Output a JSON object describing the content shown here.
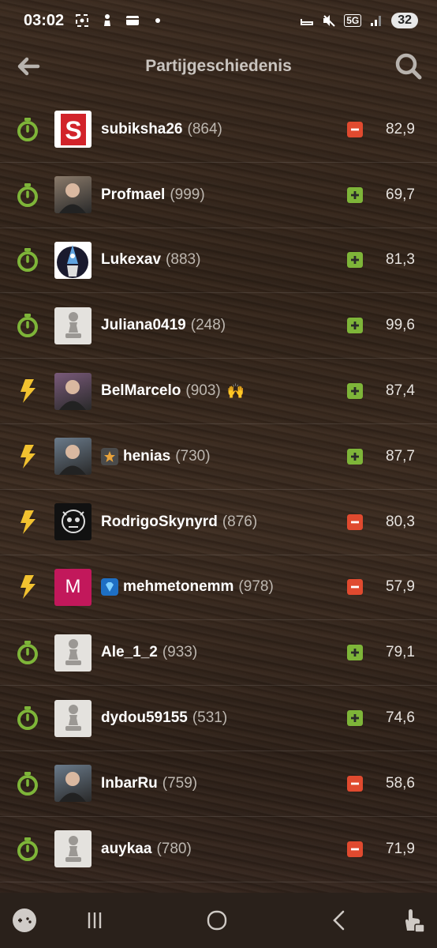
{
  "status": {
    "time": "03:02",
    "network": "5G",
    "battery": "32"
  },
  "header": {
    "title": "Partijgeschiedenis"
  },
  "colors": {
    "win": "#7eb539",
    "loss": "#e04a2f",
    "rapid_icon": "#7eb539",
    "blitz_icon": "#f2c230"
  },
  "games": [
    {
      "type": "rapid",
      "username": "subiksha26",
      "rating": "(864)",
      "result": "loss",
      "accuracy": "82,9",
      "avatar": "red-s-logo"
    },
    {
      "type": "rapid",
      "username": "Profmael",
      "rating": "(999)",
      "result": "win",
      "accuracy": "69,7",
      "avatar": "photo"
    },
    {
      "type": "rapid",
      "username": "Lukexav",
      "rating": "(883)",
      "result": "win",
      "accuracy": "81,3",
      "avatar": "cartoon-bird"
    },
    {
      "type": "rapid",
      "username": "Juliana0419",
      "rating": "(248)",
      "result": "win",
      "accuracy": "99,6",
      "avatar": "default-pawn"
    },
    {
      "type": "blitz",
      "username": "BelMarcelo",
      "rating": "(903)",
      "result": "win",
      "accuracy": "87,4",
      "avatar": "photo",
      "emoji": "🙌"
    },
    {
      "type": "blitz",
      "username": "henias",
      "rating": "(730)",
      "result": "win",
      "accuracy": "87,7",
      "avatar": "photo",
      "badge": "star"
    },
    {
      "type": "blitz",
      "username": "RodrigoSkynyrd",
      "rating": "(876)",
      "result": "loss",
      "accuracy": "80,3",
      "avatar": "skull-logo"
    },
    {
      "type": "blitz",
      "username": "mehmetonemm",
      "rating": "(978)",
      "result": "loss",
      "accuracy": "57,9",
      "avatar": "letter-m",
      "avatar_letter": "M",
      "badge": "diamond"
    },
    {
      "type": "rapid",
      "username": "Ale_1_2",
      "rating": "(933)",
      "result": "win",
      "accuracy": "79,1",
      "avatar": "default-pawn"
    },
    {
      "type": "rapid",
      "username": "dydou59155",
      "rating": "(531)",
      "result": "win",
      "accuracy": "74,6",
      "avatar": "default-pawn"
    },
    {
      "type": "rapid",
      "username": "InbarRu",
      "rating": "(759)",
      "result": "loss",
      "accuracy": "58,6",
      "avatar": "photo"
    },
    {
      "type": "rapid",
      "username": "auykaa",
      "rating": "(780)",
      "result": "loss",
      "accuracy": "71,9",
      "avatar": "default-pawn"
    }
  ]
}
